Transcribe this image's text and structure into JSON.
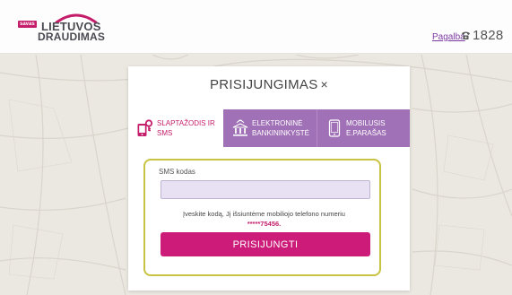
{
  "header": {
    "logo": {
      "badge": "savas",
      "line1": "LIETUVOS",
      "line2": "DRAUDIMAS"
    },
    "help_link": "Pagalba",
    "phone_number": "1828"
  },
  "modal": {
    "title": "PRISIJUNGIMAS",
    "close_symbol": "×",
    "tabs": [
      {
        "line1": "SLAPTAŽODIS IR",
        "line2": "SMS",
        "icon": "phone-key-icon",
        "active": true
      },
      {
        "line1": "ELEKTRONINĖ",
        "line2": "BANKININKYSTĖ",
        "icon": "bank-icon",
        "active": false
      },
      {
        "line1": "MOBILUSIS",
        "line2": "E.PARAŠAS",
        "icon": "mobile-icon",
        "active": false
      }
    ],
    "form": {
      "sms_label": "SMS kodas",
      "sms_value": "",
      "sms_placeholder": "",
      "hint": "Įveskite kodą, Jį išsiuntėme mobiliojo telefono numeriu",
      "masked_number": "*****75456.",
      "submit_label": "PRISIJUNGTI"
    }
  },
  "colors": {
    "brand_magenta": "#cc1b79",
    "tab_purple": "#a071b6",
    "highlight_border": "#c8c341",
    "input_bg": "#e8e1f4",
    "help_link": "#7b3aa3"
  }
}
